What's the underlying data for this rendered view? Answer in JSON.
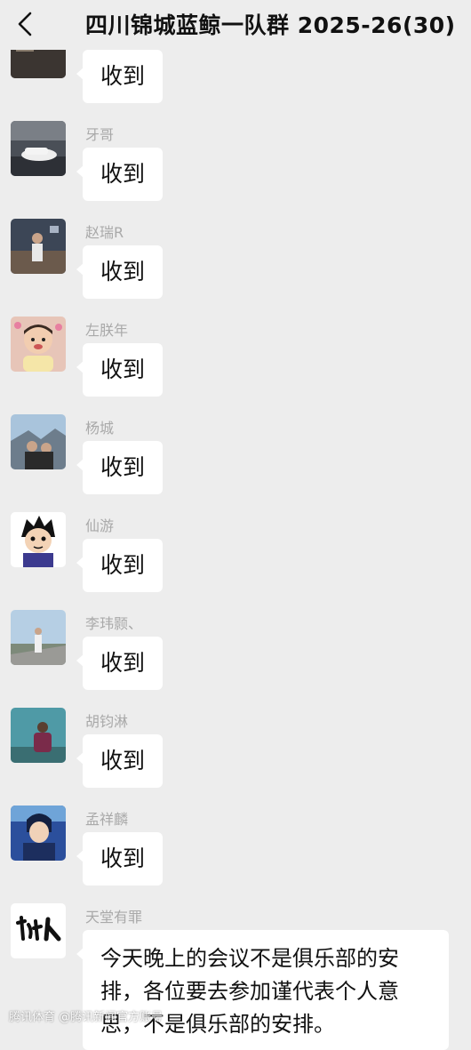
{
  "header": {
    "title": "四川锦城蓝鲸一队群 2025-26(30)"
  },
  "messages": [
    {
      "sender": "",
      "text": "收到"
    },
    {
      "sender": "牙哥",
      "text": "收到"
    },
    {
      "sender": "赵瑞R",
      "text": "收到"
    },
    {
      "sender": "左朕年",
      "text": "收到"
    },
    {
      "sender": "杨城",
      "text": "收到"
    },
    {
      "sender": "仙游",
      "text": "收到"
    },
    {
      "sender": "李玮颢、",
      "text": "收到"
    },
    {
      "sender": "胡钧淋",
      "text": "收到"
    },
    {
      "sender": "孟祥麟",
      "text": "收到"
    },
    {
      "sender": "天堂有罪",
      "text": "今天晚上的会议不是俱乐部的安排，各位要去参加谨代表个人意思，不是俱乐部的安排。"
    }
  ],
  "watermark": "腾讯体育 @腾讯新闻官方账号"
}
